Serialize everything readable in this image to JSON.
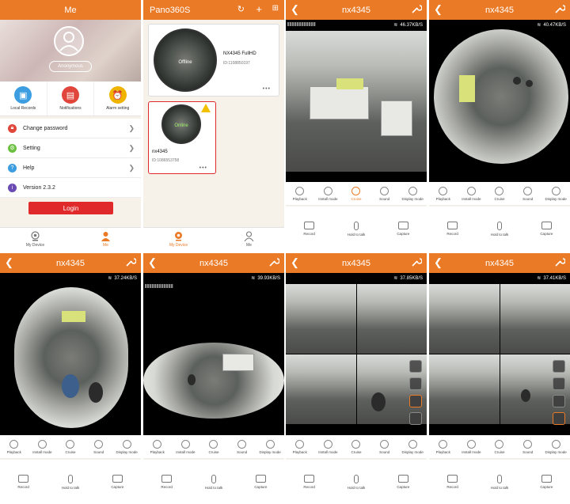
{
  "me": {
    "title": "Me",
    "username": "Anonymous",
    "quick": [
      {
        "label": "Local Records",
        "icon": "image-icon",
        "color": "#3c9de0"
      },
      {
        "label": "Notifications",
        "icon": "clipboard-icon",
        "color": "#e0463c"
      },
      {
        "label": "Alarm setting",
        "icon": "alarm-icon",
        "color": "#f0b400"
      }
    ],
    "menu": [
      {
        "label": "Change password",
        "icon": "lock-icon",
        "color": "#e0463c"
      },
      {
        "label": "Setting",
        "icon": "gear-icon",
        "color": "#6cc040"
      },
      {
        "label": "Help",
        "icon": "question-icon",
        "color": "#3c9de0"
      },
      {
        "label": "Version 2.3.2",
        "icon": "info-icon",
        "color": "#6a4bb3"
      }
    ],
    "login_label": "Login"
  },
  "devices": {
    "title": "Pano360S",
    "cards": [
      {
        "name": "NX4345 FullHD",
        "id": "ID:1108850197",
        "status": "Offline"
      },
      {
        "name": "nx4345",
        "id": "ID:1086553758",
        "status": "Online"
      }
    ]
  },
  "tabs": {
    "my_device": "My Device",
    "me": "Me"
  },
  "camera": {
    "title": "nx4345",
    "controls_row1": [
      "Playback",
      "Install mode",
      "Cruise",
      "Sound",
      "Display mode"
    ],
    "controls_row2": [
      "Record",
      "Hold to talk",
      "Capture"
    ],
    "speeds": [
      "46.37KB/S",
      "40.47KB/S",
      "37.24KB/S",
      "39.93KB/S",
      "37.85KB/S",
      "37.41KB/S"
    ]
  },
  "colors": {
    "accent": "#ea7a26",
    "login": "#e0292a"
  }
}
